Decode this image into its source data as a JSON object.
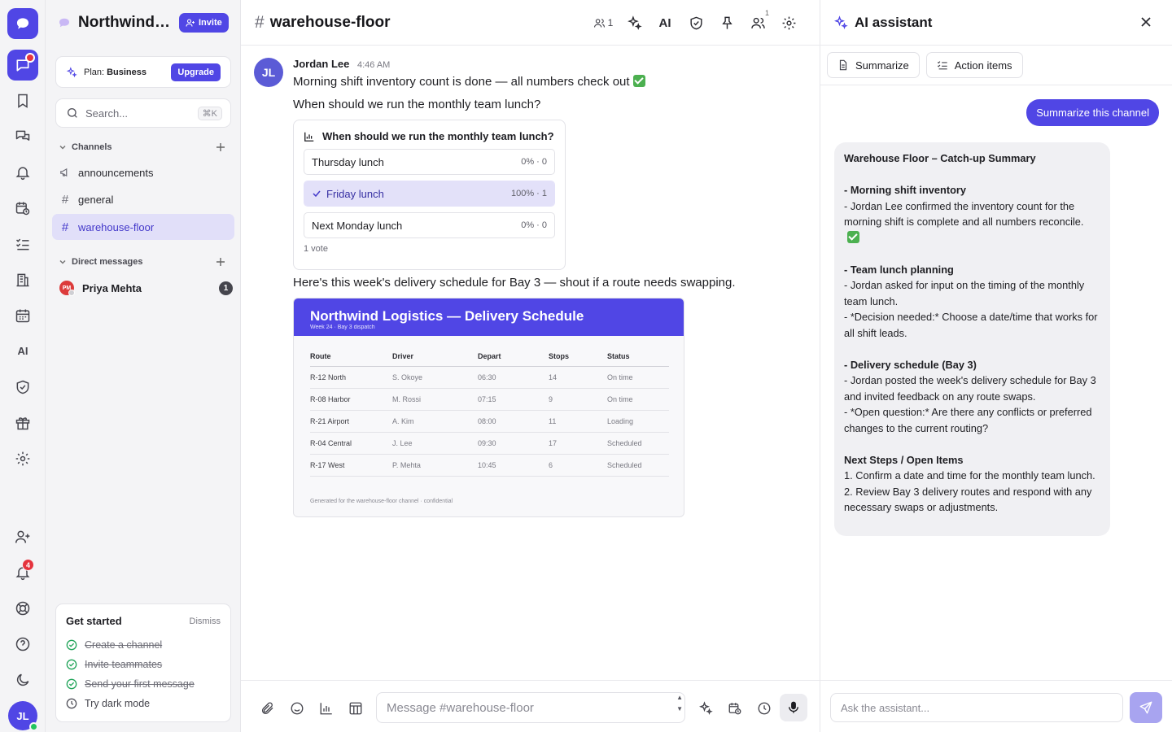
{
  "rail": {
    "ai_label": "AI",
    "notification_badge": "4",
    "user_initials": "JL"
  },
  "sidebar": {
    "workspace_name": "Northwind Logistics",
    "invite_label": "Invite",
    "plan_prefix": "Plan:",
    "plan_name": "Business",
    "upgrade_label": "Upgrade",
    "search_placeholder": "Search...",
    "search_shortcut": "⌘K",
    "channels_heading": "Channels",
    "channels": [
      {
        "name": "announcements",
        "icon": "megaphone-icon"
      },
      {
        "name": "general",
        "icon": "hash-icon"
      },
      {
        "name": "warehouse-floor",
        "icon": "hash-icon",
        "active": true
      }
    ],
    "dm_heading": "Direct messages",
    "dms": [
      {
        "name": "Priya Mehta",
        "initials": "PM",
        "unread": "1",
        "avatar_color": "#dc3b3b"
      }
    ],
    "get_started": {
      "title": "Get started",
      "dismiss": "Dismiss",
      "items": [
        {
          "label": "Create a channel",
          "done": true
        },
        {
          "label": "Invite teammates",
          "done": true
        },
        {
          "label": "Send your first message",
          "done": true
        },
        {
          "label": "Try dark mode",
          "done": false
        }
      ]
    }
  },
  "channel": {
    "name": "warehouse-floor",
    "member_count": "1",
    "ai_label": "AI",
    "members_badge": "1"
  },
  "message": {
    "author": "Jordan Lee",
    "initials": "JL",
    "time": "4:46 AM",
    "lines": [
      "Morning shift inventory count is done — all numbers check out",
      "When should we run the monthly team lunch?",
      "Here's this week's delivery schedule for Bay 3 — shout if a route needs swapping."
    ]
  },
  "poll": {
    "question": "When should we run the monthly team lunch?",
    "options": [
      {
        "label": "Thursday lunch",
        "result": "0% · 0",
        "fraction": 0,
        "selected": false
      },
      {
        "label": "Friday lunch",
        "result": "100% · 1",
        "fraction": 1,
        "selected": true
      },
      {
        "label": "Next Monday lunch",
        "result": "0% · 0",
        "fraction": 0,
        "selected": false
      }
    ],
    "votes": "1 vote"
  },
  "schedule": {
    "title": "Northwind Logistics — Delivery Schedule",
    "subtitle": "Week 24 · Bay 3 dispatch",
    "columns": [
      "Route",
      "Driver",
      "Depart",
      "Stops",
      "Status"
    ],
    "rows": [
      [
        "R-12 North",
        "S. Okoye",
        "06:30",
        "14",
        "On time"
      ],
      [
        "R-08 Harbor",
        "M. Rossi",
        "07:15",
        "9",
        "On time"
      ],
      [
        "R-21 Airport",
        "A. Kim",
        "08:00",
        "11",
        "Loading"
      ],
      [
        "R-04 Central",
        "J. Lee",
        "09:30",
        "17",
        "Scheduled"
      ],
      [
        "R-17 West",
        "P. Mehta",
        "10:45",
        "6",
        "Scheduled"
      ]
    ],
    "footer": "Generated for the warehouse-floor channel · confidential"
  },
  "composer": {
    "placeholder": "Message #warehouse-floor"
  },
  "assistant": {
    "title": "AI assistant",
    "summarize_label": "Summarize",
    "action_items_label": "Action items",
    "user_prompt": "Summarize this channel",
    "summary_title": "Warehouse Floor – Catch-up Summary",
    "s1_head": "- Morning shift inventory",
    "s1_body": "  - Jordan Lee confirmed the inventory count for the morning shift is complete and all numbers reconcile.",
    "s2_head": "- Team lunch planning",
    "s2_body1": "  - Jordan asked for input on the timing of the monthly team lunch.",
    "s2_body2": "  - *Decision needed:* Choose a date/time that works for all shift leads.",
    "s3_head": "- Delivery schedule (Bay 3)",
    "s3_body1": "  - Jordan posted the week's delivery schedule for Bay 3 and invited feedback on any route swaps.",
    "s3_body2": "  - *Open question:* Are there any conflicts or preferred changes to the current routing?",
    "next_head": "Next Steps / Open Items",
    "next_1": "1. Confirm a date and time for the monthly team lunch.",
    "next_2": "2. Review Bay 3 delivery routes and respond with any necessary swaps or adjustments.",
    "input_placeholder": "Ask the assistant..."
  },
  "colors": {
    "accent": "#5046e5",
    "accent_light": "#e1dff9",
    "success": "#22a55a",
    "danger": "#e5343e"
  }
}
